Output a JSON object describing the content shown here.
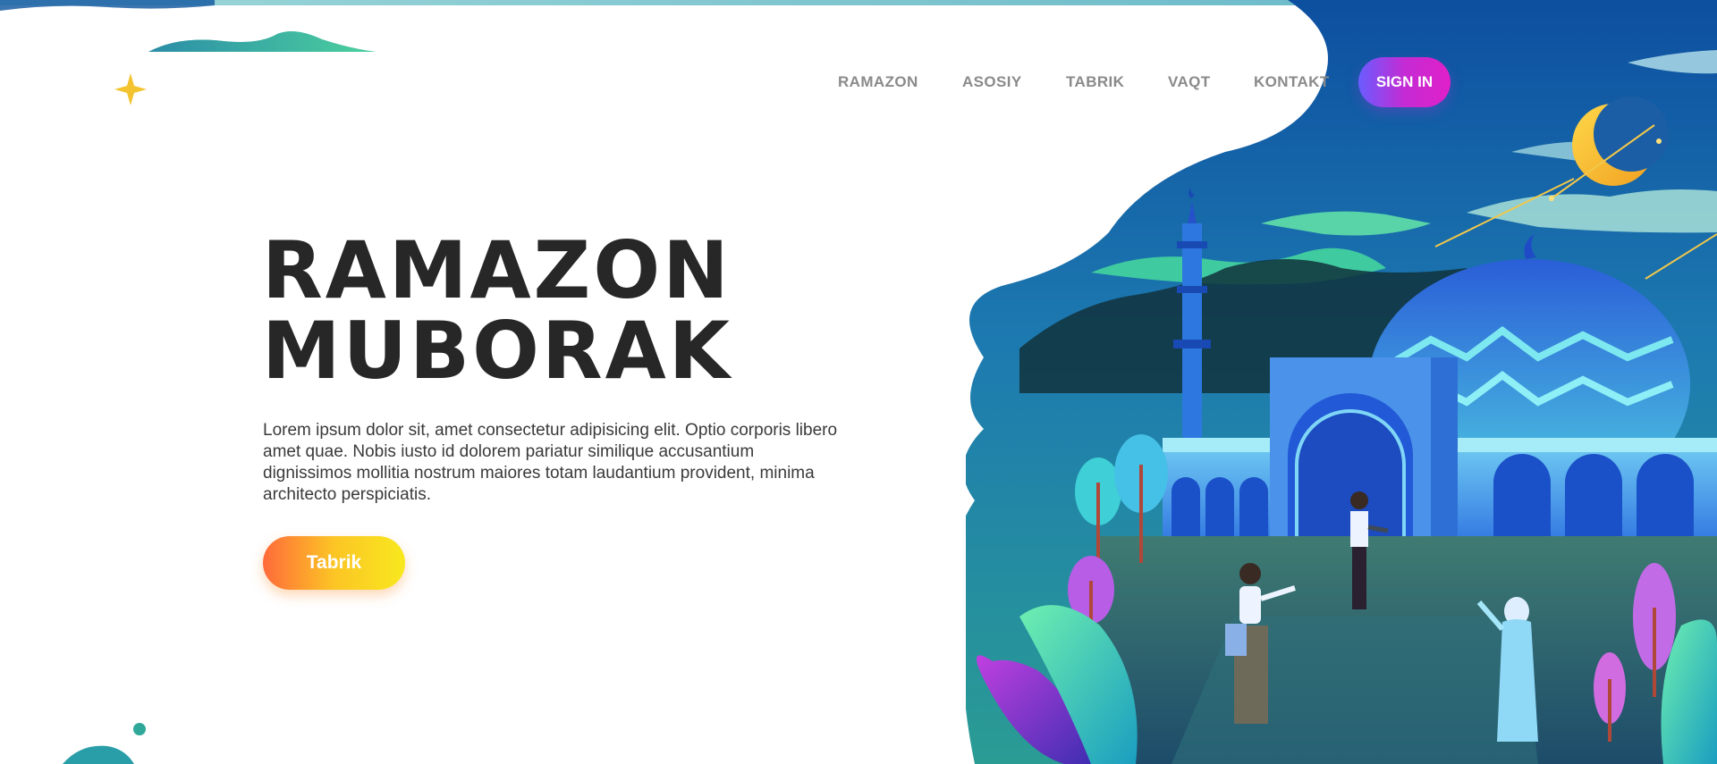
{
  "nav": {
    "items": [
      {
        "label": "RAMAZON"
      },
      {
        "label": "ASOSIY"
      },
      {
        "label": "TABRIK"
      },
      {
        "label": "VAQT"
      },
      {
        "label": "KONTAKT"
      }
    ],
    "sign_in_label": "SIGN IN"
  },
  "hero": {
    "title_line1": "RAMAZON",
    "title_line2": "MUBORAK",
    "description": "Lorem ipsum dolor sit, amet consectetur adipisicing elit. Optio corporis libero amet quae. Nobis iusto id dolorem pariatur similique accusantium dignissimos mollitia nostrum maiores totam laudantium provident, minima architecto perspiciatis.",
    "cta_label": "Tabrik"
  },
  "colors": {
    "sign_in_gradient": [
      "#6a5cff",
      "#e020c8"
    ],
    "cta_gradient": [
      "#ff6a3a",
      "#f8e81e"
    ],
    "title": "#272727",
    "nav_text": "#8a8a8a"
  },
  "icons": [
    "star-icon",
    "crescent-moon-icon"
  ]
}
